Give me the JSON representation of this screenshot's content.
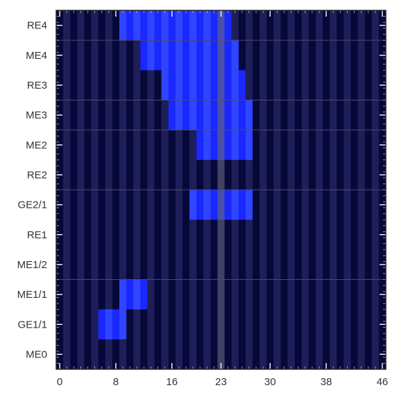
{
  "chart_data": {
    "type": "heatmap",
    "x_ticks": [
      0,
      8,
      16,
      23,
      30,
      38,
      46
    ],
    "xlim": [
      0,
      46
    ],
    "rows": [
      "ME0",
      "GE1/1",
      "ME1/1",
      "ME1/2",
      "RE1",
      "GE2/1",
      "RE2",
      "ME2",
      "ME3",
      "RE3",
      "ME4",
      "RE4"
    ],
    "highlight_x": 23,
    "cells": [
      {
        "row": "GE1/1",
        "x_start": 6,
        "x_end": 10
      },
      {
        "row": "ME1/1",
        "x_start": 9,
        "x_end": 13
      },
      {
        "row": "GE2/1",
        "x_start": 19,
        "x_end": 28
      },
      {
        "row": "ME2",
        "x_start": 20,
        "x_end": 28
      },
      {
        "row": "ME3",
        "x_start": 16,
        "x_end": 28
      },
      {
        "row": "RE3",
        "x_start": 15,
        "x_end": 27
      },
      {
        "row": "ME4",
        "x_start": 12,
        "x_end": 26
      },
      {
        "row": "RE4",
        "x_start": 9,
        "x_end": 25
      }
    ],
    "colors": {
      "background": "#07083a",
      "stripe": "#1e1f58",
      "active": "#1a28ff",
      "active_stripe": "#3045ff",
      "highlight": "#5a5a72",
      "station_line": "#4a4a6e",
      "frame": "#222222"
    }
  }
}
